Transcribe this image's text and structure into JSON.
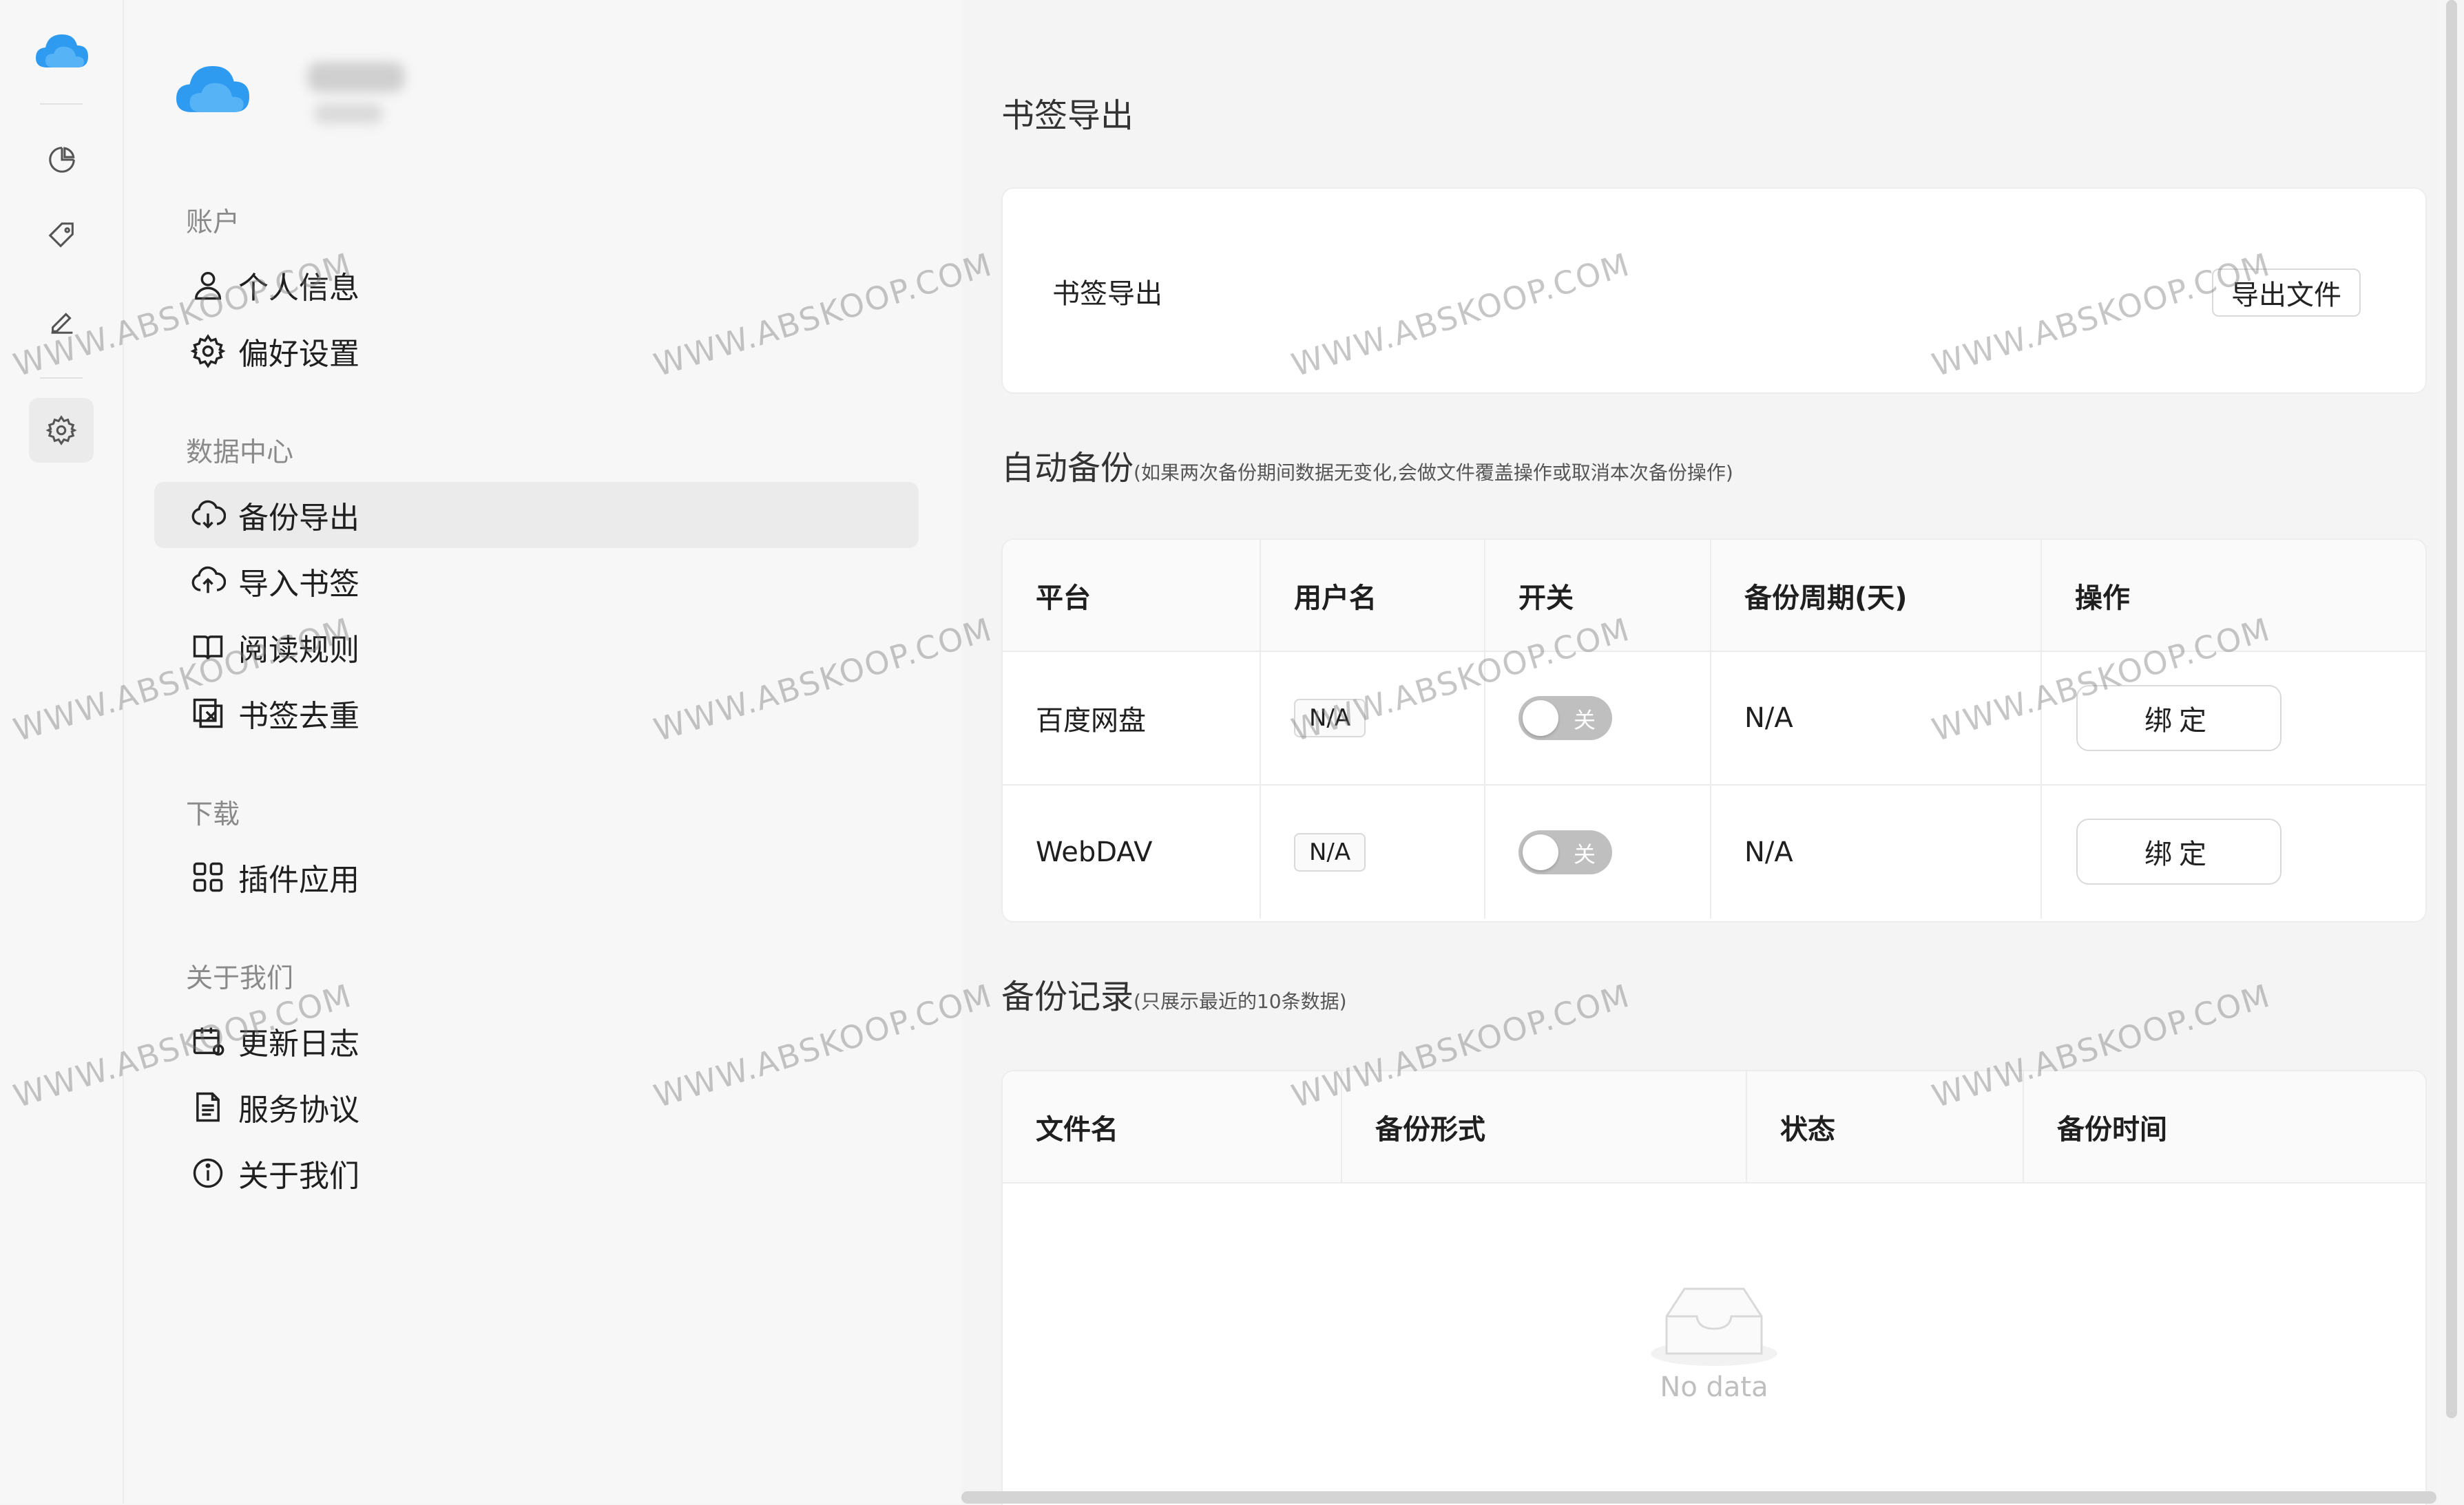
{
  "sidebar": {
    "sections": [
      {
        "title": "账户",
        "items": [
          {
            "label": "个人信息",
            "icon": "user-icon"
          },
          {
            "label": "偏好设置",
            "icon": "gear-icon"
          }
        ]
      },
      {
        "title": "数据中心",
        "items": [
          {
            "label": "备份导出",
            "icon": "cloud-download-icon",
            "active": true
          },
          {
            "label": "导入书签",
            "icon": "cloud-upload-icon"
          },
          {
            "label": "阅读规则",
            "icon": "book-icon"
          },
          {
            "label": "书签去重",
            "icon": "dedupe-icon"
          }
        ]
      },
      {
        "title": "下载",
        "items": [
          {
            "label": "插件应用",
            "icon": "apps-grid-icon"
          }
        ]
      },
      {
        "title": "关于我们",
        "items": [
          {
            "label": "更新日志",
            "icon": "calendar-icon"
          },
          {
            "label": "服务协议",
            "icon": "document-icon"
          },
          {
            "label": "关于我们",
            "icon": "info-icon"
          }
        ]
      }
    ]
  },
  "rail": {
    "icons": [
      "cloud-logo-icon",
      "pie-chart-icon",
      "tag-icon",
      "pen-icon",
      "gear-icon"
    ],
    "active": "gear-icon"
  },
  "main": {
    "export": {
      "title": "书签导出",
      "label": "书签导出",
      "button": "导出文件"
    },
    "auto_backup": {
      "title": "自动备份",
      "note": "(如果两次备份期间数据无变化,会做文件覆盖操作或取消本次备份操作)",
      "columns": [
        "平台",
        "用户名",
        "开关",
        "备份周期(天)",
        "操作"
      ],
      "rows": [
        {
          "platform": "百度网盘",
          "username": "N/A",
          "switch": "关",
          "period": "N/A",
          "action": "绑定"
        },
        {
          "platform": "WebDAV",
          "username": "N/A",
          "switch": "关",
          "period": "N/A",
          "action": "绑定"
        }
      ]
    },
    "records": {
      "title": "备份记录",
      "note": "(只展示最近的10条数据)",
      "columns": [
        "文件名",
        "备份形式",
        "状态",
        "备份时间"
      ],
      "empty": "No data"
    }
  },
  "watermark": "WWW.ABSKOOP.COM",
  "colors": {
    "accent": "#2f9bf0",
    "switch_off": "#bfbfbf",
    "active_bg": "#ebebeb"
  }
}
